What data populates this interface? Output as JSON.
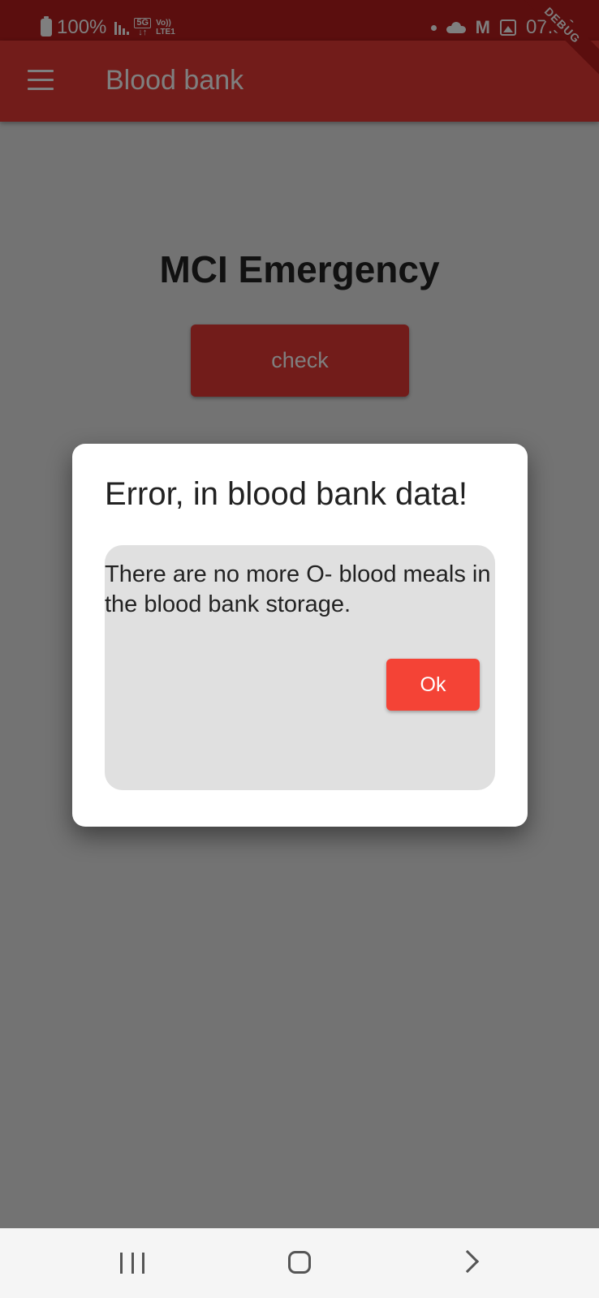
{
  "status_bar": {
    "battery": "100%",
    "network_5g": "5G",
    "network_volte_line1": "Vo))",
    "network_volte_line2": "LTE1",
    "gmail": "M",
    "time": "07:56"
  },
  "debug_banner": "DEBUG",
  "app_bar": {
    "title": "Blood bank",
    "menu_icon": "hamburger-menu-icon"
  },
  "page": {
    "heading": "MCI Emergency",
    "check_button_label": "check"
  },
  "dialog": {
    "title": "Error, in blood bank data!",
    "message": "There are no more O- blood meals in the blood bank storage.",
    "ok_label": "Ok"
  },
  "nav_bar": {
    "icons": [
      "recent-apps-icon",
      "home-icon",
      "back-icon"
    ]
  },
  "colors": {
    "primary": "#e53935",
    "status_bar": "#b71c1c",
    "ok_button": "#f44336",
    "dialog_content_bg": "#e0e0e0"
  }
}
